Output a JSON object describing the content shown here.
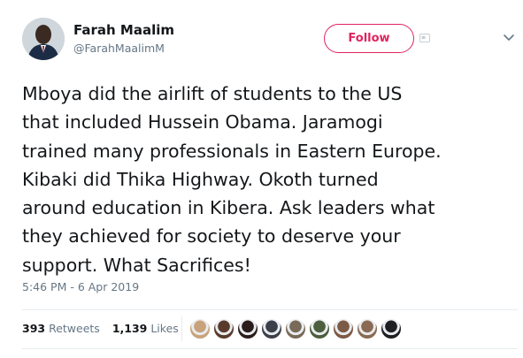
{
  "user": {
    "name": "Farah Maalim",
    "handle": "@FarahMaalimM"
  },
  "follow_button": {
    "label": "Follow"
  },
  "tweet": {
    "text": "Mboya did the airlift of students to the US\nthat included Hussein Obama. Jaramogi\ntrained many professionals in Eastern Europe.\nKibaki did Thika Highway. Okoth turned\naround education in Kibera. Ask leaders what\nthey achieved for society to deserve your\nsupport. What Sacrifices!",
    "timestamp": "5:46 PM - 6 Apr 2019"
  },
  "stats": {
    "retweets_count": "393",
    "retweets_label": "Retweets",
    "likes_count": "1,139",
    "likes_label": "Likes"
  },
  "likers": [
    {
      "color": "#c8a27a"
    },
    {
      "color": "#5a3b2b"
    },
    {
      "color": "#2b1e1a"
    },
    {
      "color": "#3b3f49"
    },
    {
      "color": "#7a6a58"
    },
    {
      "color": "#4c5f3e"
    },
    {
      "color": "#7d5a44"
    },
    {
      "color": "#8a6a52"
    },
    {
      "color": "#1f1f22"
    }
  ],
  "colors": {
    "accent": "#e0245e",
    "secondary_text": "#657786",
    "primary_text": "#14171a"
  },
  "icons": {
    "avatar": "profile-photo",
    "follow_extra": "card-icon",
    "menu": "chevron-down-icon"
  }
}
